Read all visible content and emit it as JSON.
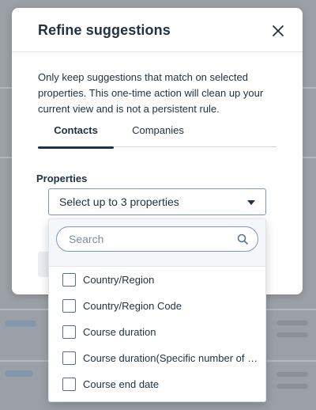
{
  "modal": {
    "title": "Refine suggestions",
    "description": "Only keep suggestions that match on selected properties. This one-time action will clean up your current view and is not a persistent rule."
  },
  "tabs": [
    {
      "label": "Contacts",
      "active": true
    },
    {
      "label": "Companies",
      "active": false
    }
  ],
  "properties": {
    "label": "Properties",
    "select_placeholder": "Select up to 3 properties",
    "search_placeholder": "Search",
    "options": [
      {
        "label": "",
        "checked": false
      },
      {
        "label": "Country/Region",
        "checked": false
      },
      {
        "label": "Country/Region Code",
        "checked": false
      },
      {
        "label": "Course duration",
        "checked": false
      },
      {
        "label": "Course duration(Specific number of da...",
        "checked": false
      },
      {
        "label": "Course end date",
        "checked": false
      }
    ]
  },
  "icons": {
    "close": "close-icon",
    "search": "search-icon",
    "caret": "caret-down-icon"
  },
  "colors": {
    "text": "#213343",
    "border": "#7c98b6",
    "overlay": "#8a8f94"
  }
}
